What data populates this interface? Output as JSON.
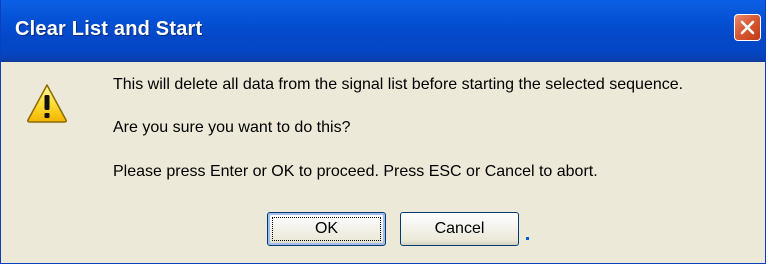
{
  "window": {
    "title": "Clear List and Start"
  },
  "icons": {
    "warning": "warning-icon",
    "close": "close-icon"
  },
  "message": {
    "line1": "This will delete all data from the signal list before starting the selected sequence.",
    "line2": "Are you sure you want to do this?",
    "line3": "Please press Enter or OK to proceed. Press ESC or Cancel to abort."
  },
  "buttons": {
    "ok_label": "OK",
    "cancel_label": "Cancel"
  },
  "colors": {
    "titlebar": "#0552d6",
    "close_button": "#d85a33",
    "dialog_background": "#ece9d8"
  }
}
